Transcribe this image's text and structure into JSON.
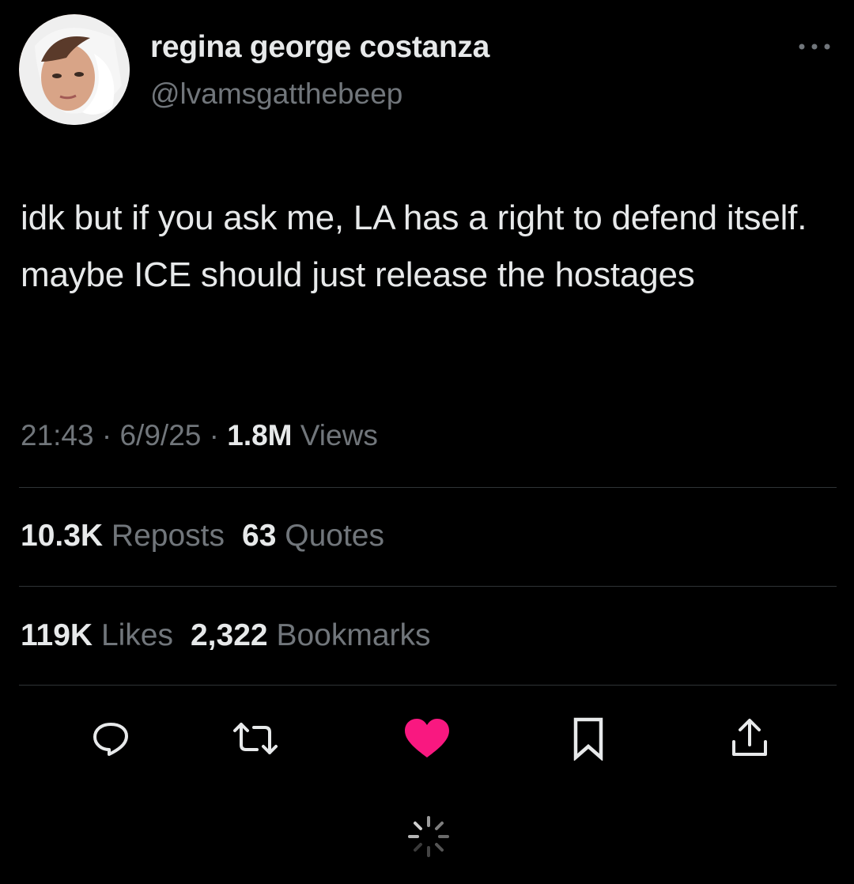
{
  "tweet": {
    "author": {
      "display_name": "regina george costanza",
      "handle": "@lvamsgatthebeep"
    },
    "text": "idk but if you ask me, LA has a right to defend itself. maybe ICE should just release the hostages",
    "meta": {
      "time": "21:43",
      "separator": "·",
      "date": "6/9/25",
      "views_count": "1.8M",
      "views_label": "Views"
    },
    "stats": {
      "reposts_count": "10.3K",
      "reposts_label": "Reposts",
      "quotes_count": "63",
      "quotes_label": "Quotes",
      "likes_count": "119K",
      "likes_label": "Likes",
      "bookmarks_count": "2,322",
      "bookmarks_label": "Bookmarks"
    },
    "actions": {
      "icons": [
        "reply-icon",
        "repost-icon",
        "like-icon",
        "bookmark-icon",
        "share-icon"
      ],
      "liked": true
    },
    "colors": {
      "background": "#000000",
      "primary_text": "#e7e9ea",
      "secondary_text": "#71767b",
      "like_active": "#f91880",
      "divider": "#2f3336"
    }
  }
}
